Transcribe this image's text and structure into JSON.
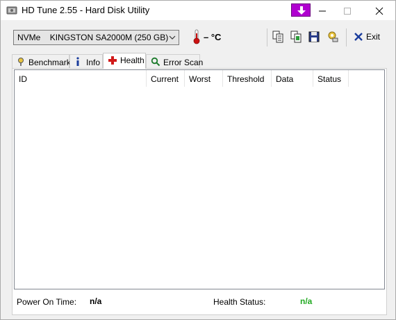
{
  "window": {
    "title": "HD Tune 2.55 - Hard Disk Utility"
  },
  "toolbar": {
    "drive_type": "NVMe",
    "drive_name": "KINGSTON SA2000M (250 GB)",
    "temperature": "– °C",
    "exit_label": "Exit",
    "icons": [
      "copy-text-icon",
      "copy-screenshot-icon",
      "save-icon",
      "options-icon"
    ]
  },
  "tabs": [
    {
      "label": "Benchmark",
      "icon": "benchmark-icon",
      "active": false
    },
    {
      "label": "Info",
      "icon": "info-icon",
      "active": false
    },
    {
      "label": "Health",
      "icon": "health-cross-icon",
      "active": true
    },
    {
      "label": "Error Scan",
      "icon": "magnifier-icon",
      "active": false
    }
  ],
  "health": {
    "columns": [
      "ID",
      "Current",
      "Worst",
      "Threshold",
      "Data",
      "Status"
    ],
    "rows": []
  },
  "footer": {
    "power_on_label": "Power On Time:",
    "power_on_value": "n/a",
    "health_status_label": "Health Status:",
    "health_status_value": "n/a"
  },
  "colors": {
    "health_status_value": "#22aa22",
    "update_button": "#b000d0",
    "thermometer": "#cc1111"
  }
}
